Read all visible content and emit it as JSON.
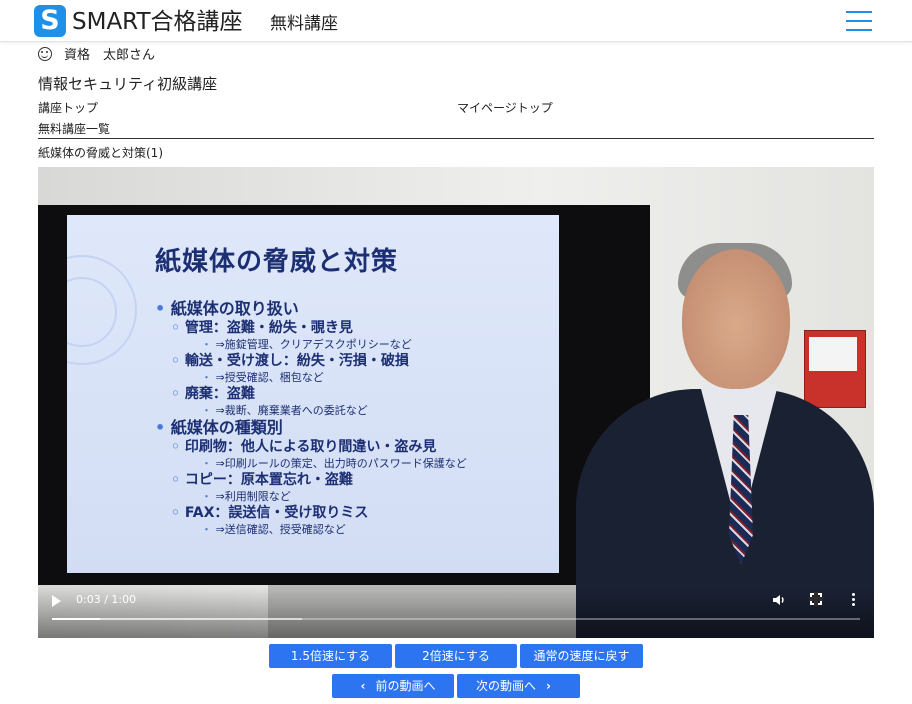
{
  "header": {
    "logo_letter": "S",
    "brand": "SMART合格講座",
    "subtitle": "無料講座",
    "menu_icon": "hamburger-icon"
  },
  "user": {
    "icon": "smile-icon",
    "label": "資格　太郎さん"
  },
  "course": {
    "title": "情報セキュリティ初級講座"
  },
  "nav": {
    "course_top": "講座トップ",
    "mypage_top": "マイページトップ",
    "free_courses": "無料講座一覧"
  },
  "lesson": {
    "title": "紙媒体の脅威と対策(1)"
  },
  "slide": {
    "title": "紙媒体の脅威と対策",
    "lines": [
      {
        "level": 1,
        "bullet": "•",
        "text": "紙媒体の取り扱い"
      },
      {
        "level": 2,
        "bullet": "◦",
        "text": "管理：盗難・紛失・覗き見"
      },
      {
        "level": 3,
        "bullet": "・",
        "text": "⇒施錠管理、クリアデスクポリシーなど"
      },
      {
        "level": 2,
        "bullet": "◦",
        "text": "輸送・受け渡し：紛失・汚損・破損"
      },
      {
        "level": 3,
        "bullet": "・",
        "text": "⇒授受確認、梱包など"
      },
      {
        "level": 2,
        "bullet": "◦",
        "text": "廃棄：盗難"
      },
      {
        "level": 3,
        "bullet": "・",
        "text": "⇒裁断、廃棄業者への委託など"
      },
      {
        "level": 1,
        "bullet": "•",
        "text": "紙媒体の種類別"
      },
      {
        "level": 2,
        "bullet": "◦",
        "text": "印刷物：他人による取り間違い・盗み見"
      },
      {
        "level": 3,
        "bullet": "・",
        "text": "⇒印刷ルールの策定、出力時のパスワード保護など"
      },
      {
        "level": 2,
        "bullet": "◦",
        "text": "コピー：原本置忘れ・盗難"
      },
      {
        "level": 3,
        "bullet": "・",
        "text": "⇒利用制限など"
      },
      {
        "level": 2,
        "bullet": "◦",
        "text": "FAX：誤送信・受け取りミス"
      },
      {
        "level": 3,
        "bullet": "・",
        "text": "⇒送信確認、授受確認など"
      }
    ]
  },
  "player": {
    "time": "0:03 / 1:00",
    "played_fraction": 0.06,
    "buffered_fraction": 0.31,
    "icons": [
      "play-icon",
      "volume-icon",
      "fullscreen-icon",
      "more-options-icon"
    ]
  },
  "speed_buttons": {
    "speed_15": "1.5倍速にする",
    "speed_2": "2倍速にする",
    "speed_normal": "通常の速度に戻す"
  },
  "nav_buttons": {
    "prev": "前の動画へ",
    "next": "次の動画へ"
  },
  "colors": {
    "brand_blue": "#1e90e8",
    "button_blue": "#2d74f0",
    "slide_text": "#1c2f73"
  }
}
